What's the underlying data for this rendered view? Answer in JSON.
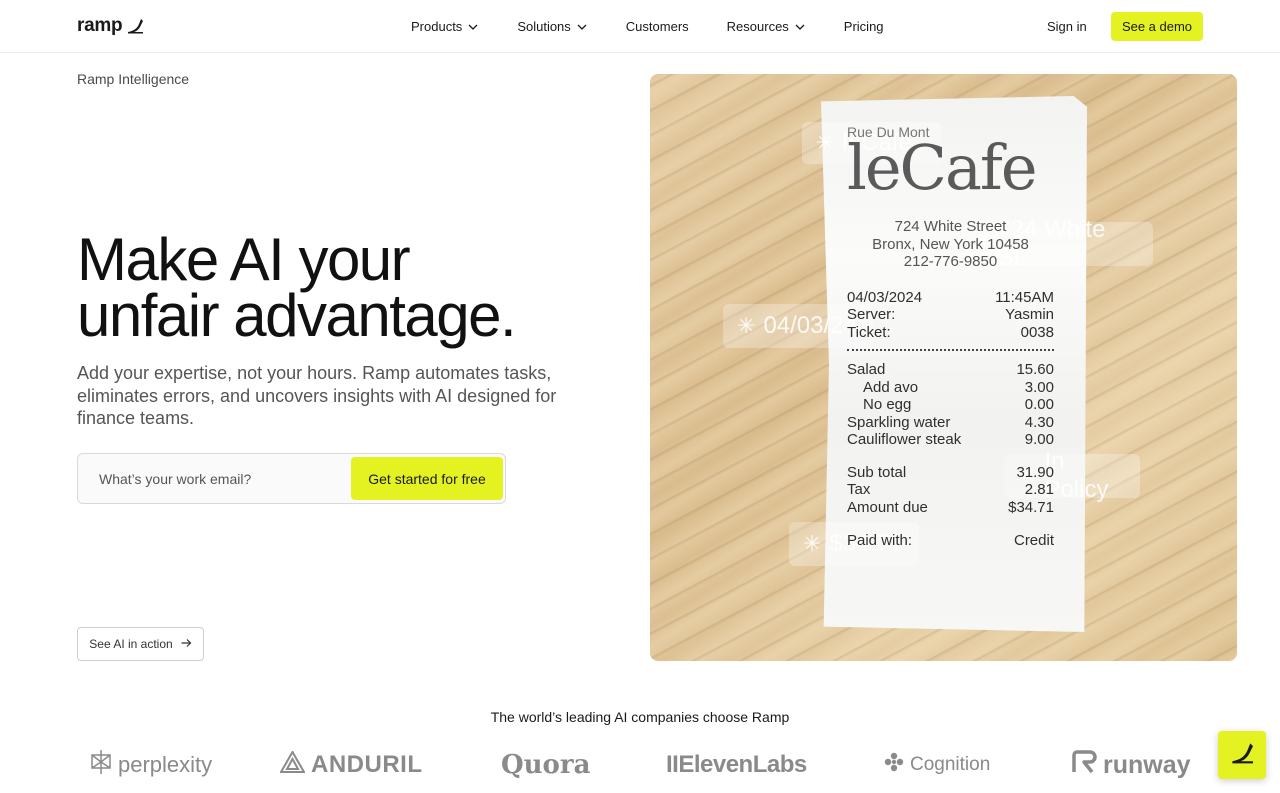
{
  "nav": {
    "logo": "ramp",
    "products": "Products",
    "solutions": "Solutions",
    "customers": "Customers",
    "resources": "Resources",
    "pricing": "Pricing",
    "sign_in": "Sign in",
    "demo": "See a demo"
  },
  "hero": {
    "eyebrow": "Ramp Intelligence",
    "headline_line1": "Make AI your",
    "headline_line2": "unfair advantage.",
    "subhead": "Add your expertise, not your hours. Ramp automates tasks, eliminates errors, and uncovers insights with AI designed for finance teams.",
    "email_placeholder": "What’s your work email?",
    "cta": "Get started for free",
    "action": "See AI in action"
  },
  "receipt": {
    "top": "Rue Du Mont",
    "brand": "leCafe",
    "address1": "724 White Street",
    "address2": "Bronx, New York 10458",
    "phone": "212-776-9850",
    "date": "04/03/2024",
    "time": "11:45AM",
    "server_label": "Server:",
    "server": "Yasmin",
    "ticket_label": "Ticket:",
    "ticket": "0038",
    "items": [
      {
        "name": "Salad",
        "price": "15.60"
      },
      {
        "name": "Add avo",
        "price": "3.00"
      },
      {
        "name": "No egg",
        "price": "0.00"
      },
      {
        "name": "Sparkling water",
        "price": "4.30"
      },
      {
        "name": "Cauliflower steak",
        "price": "9.00"
      }
    ],
    "subtotal_label": "Sub total",
    "subtotal": "31.90",
    "tax_label": "Tax",
    "tax": "2.81",
    "amount_label": "Amount due",
    "amount": "$34.71",
    "paid_label": "Paid with:",
    "paid": "Credit"
  },
  "tags": {
    "cafe": "leCafe",
    "street": "724 White St.",
    "date": "04/03/24",
    "policy": "In Policy",
    "amount": "$34.71"
  },
  "logos": {
    "title": "The world’s leading AI companies choose Ramp",
    "items": [
      "perplexity",
      "ANDURIL",
      "Quora",
      "IIElevenLabs",
      "Cognition",
      "runway"
    ]
  },
  "colors": {
    "accent": "#e4f222"
  }
}
